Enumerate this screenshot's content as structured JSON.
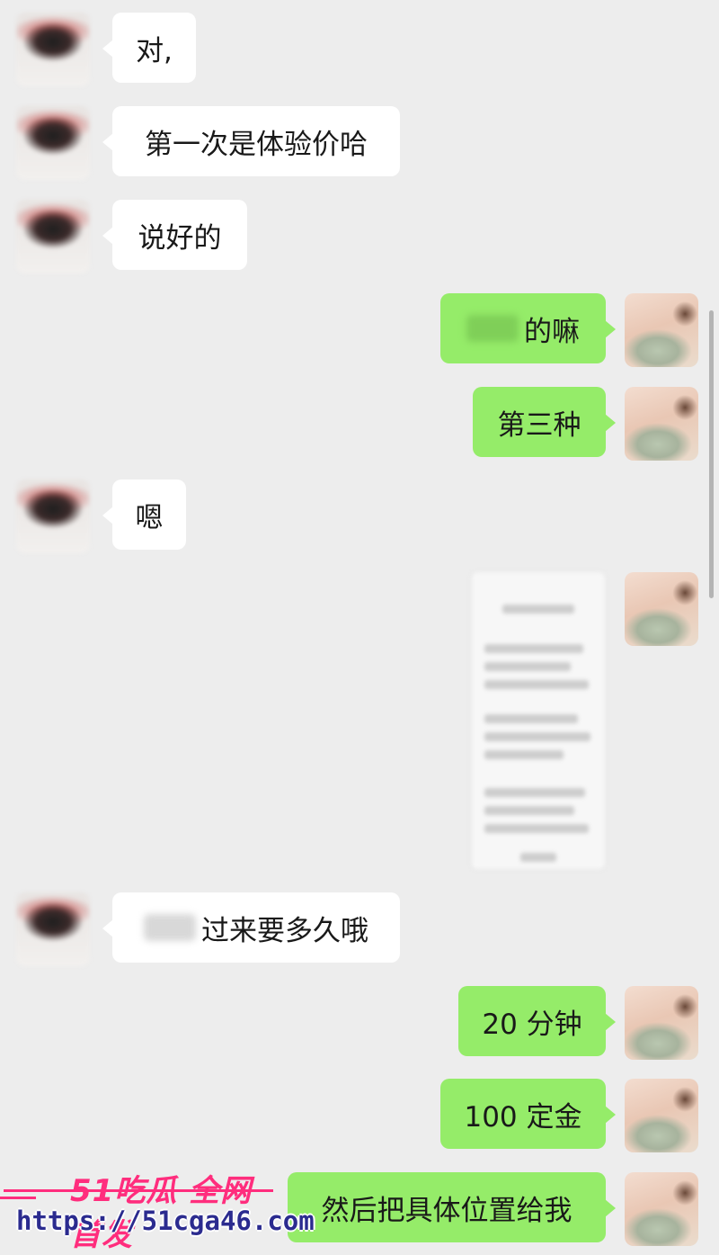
{
  "messages": [
    {
      "id": "m1",
      "side": "in",
      "text": "对,"
    },
    {
      "id": "m2",
      "side": "in",
      "text": "第一次是体验价哈"
    },
    {
      "id": "m3",
      "side": "in",
      "text": "说好的"
    },
    {
      "id": "m4",
      "side": "out",
      "text": "的嘛",
      "redacted_prefix": true
    },
    {
      "id": "m5",
      "side": "out",
      "text": "第三种"
    },
    {
      "id": "m6",
      "side": "in",
      "text": "嗯"
    },
    {
      "id": "m7",
      "side": "out",
      "type": "image",
      "text": ""
    },
    {
      "id": "m8",
      "side": "in",
      "text": "过来要多久哦",
      "redacted_prefix": true
    },
    {
      "id": "m9",
      "side": "out",
      "text": "20 分钟"
    },
    {
      "id": "m10",
      "side": "out",
      "text": "100 定金"
    },
    {
      "id": "m11",
      "side": "out",
      "text": "然后把具体位置给我"
    }
  ],
  "watermark": {
    "title": "51吃瓜 全网首发",
    "url": "https://51cga46.com"
  },
  "colors": {
    "background": "#ededed",
    "incoming_bubble": "#ffffff",
    "outgoing_bubble": "#95ec69",
    "watermark_accent": "#ff2d7d"
  }
}
